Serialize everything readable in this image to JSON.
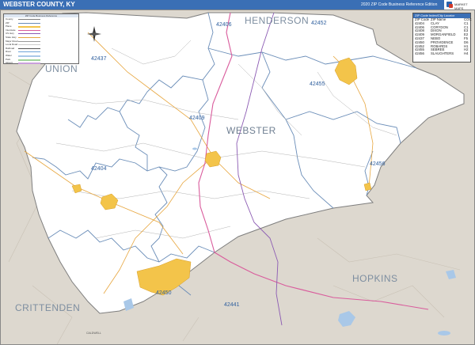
{
  "header": {
    "title": "WEBSTER COUNTY, KY",
    "edition": "2020 ZIP Code Business Reference Edition",
    "brand": "MARKET MAPS",
    "bar_color": "#3a6fb5"
  },
  "legend": {
    "title": "ZIP Code Business Reference",
    "rows": [
      "County",
      "ZIP",
      "Place",
      "Interstate",
      "US Hwy",
      "State Hwy",
      "Major Road",
      "Local Road",
      "Railroad",
      "River",
      "Water",
      "Park",
      "Airport",
      "Military"
    ]
  },
  "zip_table": {
    "title": "ZIP Code Index/City Locator",
    "headers": [
      "ZIP Code",
      "ZIP Name",
      "COC"
    ],
    "rows": [
      [
        "42404",
        "CLAY",
        "C1"
      ],
      [
        "42406",
        "CORYDON",
        "C1"
      ],
      [
        "42408",
        "DIXON",
        "E3"
      ],
      [
        "42409",
        "MORGANFIELD",
        "E2"
      ],
      [
        "42437",
        "NEBO",
        "F5"
      ],
      [
        "42450",
        "PROVIDENCE",
        "D6"
      ],
      [
        "42452",
        "ROBARDS",
        "H1"
      ],
      [
        "42455",
        "SEBREE",
        "H2"
      ],
      [
        "42456",
        "SLAUGHTERS",
        "H4"
      ]
    ]
  },
  "labels": {
    "henderson": "HENDERSON",
    "union": "UNION",
    "webster": "WEBSTER",
    "hopkins": "HOPKINS",
    "crittenden": "CRITTENDEN",
    "caldwell": "CALDWELL",
    "zips": {
      "z42406": "42406",
      "z42452": "42452",
      "z42437": "42437",
      "z42455": "42455",
      "z42409": "42409",
      "z42404": "42404",
      "z42456": "42456",
      "z42450": "42450",
      "z42441": "42441"
    }
  },
  "colors": {
    "outside": "#ddd8cf",
    "county_fill": "#ffffff",
    "zip_line": "#6a8db8",
    "city_fill": "#f3c44a",
    "road_pink": "#d95b9c",
    "road_purple": "#8c5bb3",
    "water": "#a9c8e8"
  },
  "compass_icon": "compass-icon"
}
